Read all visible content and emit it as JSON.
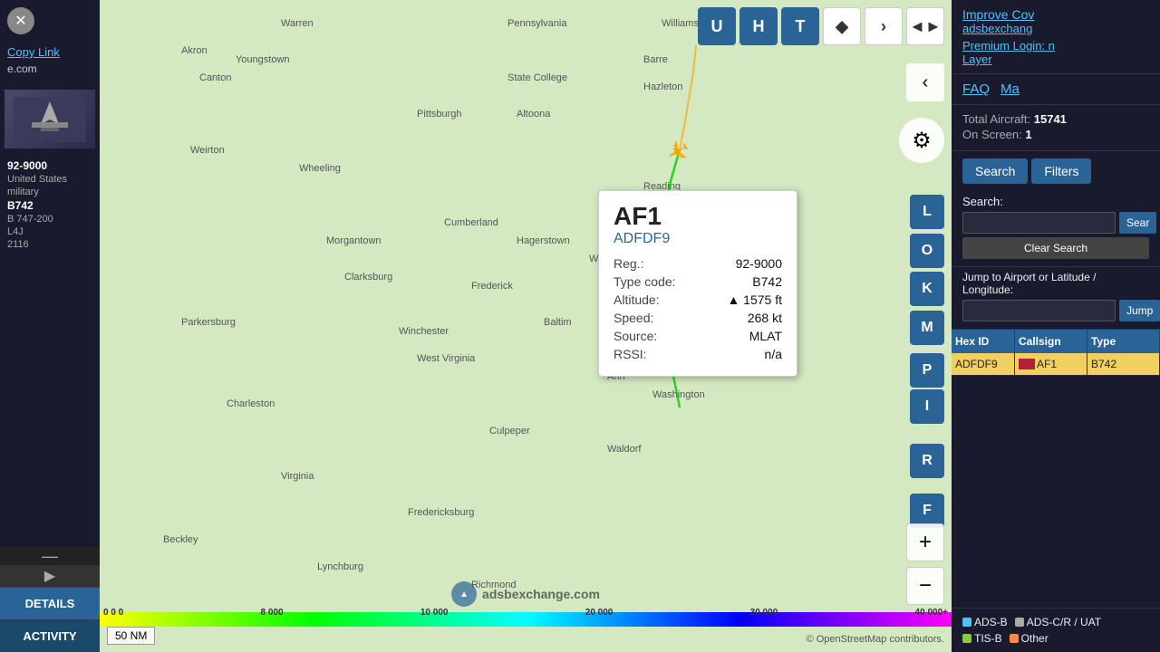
{
  "left_sidebar": {
    "copy_link_label": "Copy Link",
    "site_url": "e.com",
    "aircraft_info": {
      "registration": "92-9000",
      "country": "United States",
      "category": "military",
      "type": "B742",
      "full_type": "B 747-200",
      "squawk": "L4J",
      "flight": "2116"
    },
    "details_btn": "DETAILS",
    "activity_btn": "ACTIVITY"
  },
  "aircraft_popup": {
    "callsign": "AF1",
    "hex": "ADFDF9",
    "reg_label": "Reg.:",
    "reg_value": "92-9000",
    "type_label": "Type code:",
    "type_value": "B742",
    "altitude_label": "Altitude:",
    "altitude_value": "▲ 1575 ft",
    "speed_label": "Speed:",
    "speed_value": "268 kt",
    "source_label": "Source:",
    "source_value": "MLAT",
    "rssi_label": "RSSI:",
    "rssi_value": "n/a"
  },
  "map_controls": {
    "btn_u": "U",
    "btn_h": "H",
    "btn_t": "T",
    "btn_layer": "◆",
    "btn_next": "›",
    "btn_arrows": "◄►",
    "btn_back": "‹",
    "btn_l": "L",
    "btn_o": "O",
    "btn_k": "K",
    "btn_m": "M",
    "btn_p": "P",
    "btn_i": "I",
    "btn_r": "R",
    "btn_f": "F",
    "gear_icon": "⚙",
    "zoom_plus": "+",
    "zoom_minus": "−"
  },
  "color_bar": {
    "labels": [
      "0 0 0",
      "8 000",
      "10 000",
      "20 000",
      "30 000",
      "40 000+"
    ]
  },
  "distance_indicator": "50 NM",
  "watermark": "adsbexchange.com",
  "osm_attribution": "© OpenStreetMap contributors.",
  "right_panel": {
    "improve_link": "Improve Cov",
    "adsbexchange_link": "adsbexchang",
    "premium_text": "Premium Login: n",
    "layer_link": "Layer",
    "nav_faq": "FAQ",
    "nav_map": "Ma",
    "total_aircraft_label": "Total Aircraft:",
    "total_aircraft_value": "15741",
    "on_screen_label": "On Screen:",
    "on_screen_value": "1",
    "search_btn": "Search",
    "filters_btn": "Filters",
    "search_label": "Search:",
    "search_placeholder": "",
    "search_go_btn": "Sear",
    "clear_search_btn": "Clear Search",
    "jump_label": "Jump to Airport or Latitude / Longitude:",
    "jump_placeholder": "",
    "jump_btn": "Jump",
    "table_header": {
      "hex_id": "Hex ID",
      "callsign": "Callsign",
      "type": "Type"
    },
    "table_rows": [
      {
        "hex": "ADFDF9",
        "flag": "US",
        "callsign": "AF1",
        "type": "B742",
        "selected": true
      }
    ],
    "legend": {
      "adsb": "ADS-B",
      "adsc": "ADS-C/R / UAT",
      "tis": "TIS-B",
      "other": "Other"
    }
  }
}
